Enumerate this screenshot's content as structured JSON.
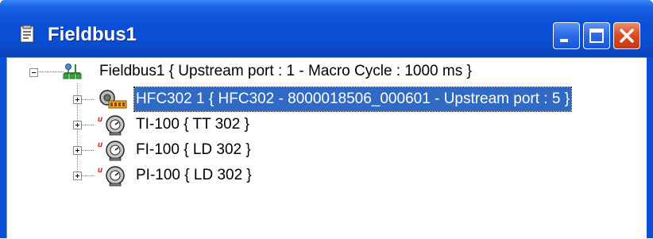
{
  "window": {
    "title": "Fieldbus1",
    "icon": "document-icon"
  },
  "title_buttons": {
    "minimize": "minimize-icon",
    "maximize": "maximize-icon",
    "close": "close-icon"
  },
  "tree": {
    "root": {
      "label": "Fieldbus1 {  Upstream port : 1 -  Macro Cycle : 1000 ms  }",
      "icon": "fieldbus-network-icon",
      "expanded": true
    },
    "children": [
      {
        "label": "HFC302 1 { HFC302 - 8000018506_000601 -  Upstream port : 5 }",
        "icon": "bridge-device-icon",
        "selected": true
      },
      {
        "label": "TI-100 { TT 302 }",
        "icon": "field-device-icon",
        "selected": false
      },
      {
        "label": "FI-100 { LD 302 }",
        "icon": "field-device-icon",
        "selected": false
      },
      {
        "label": "PI-100 { LD 302 }",
        "icon": "field-device-icon",
        "selected": false
      }
    ]
  },
  "colors": {
    "titlebar": "#0a4fd8",
    "selection": "#316ac5",
    "close_button": "#dc4a22"
  }
}
